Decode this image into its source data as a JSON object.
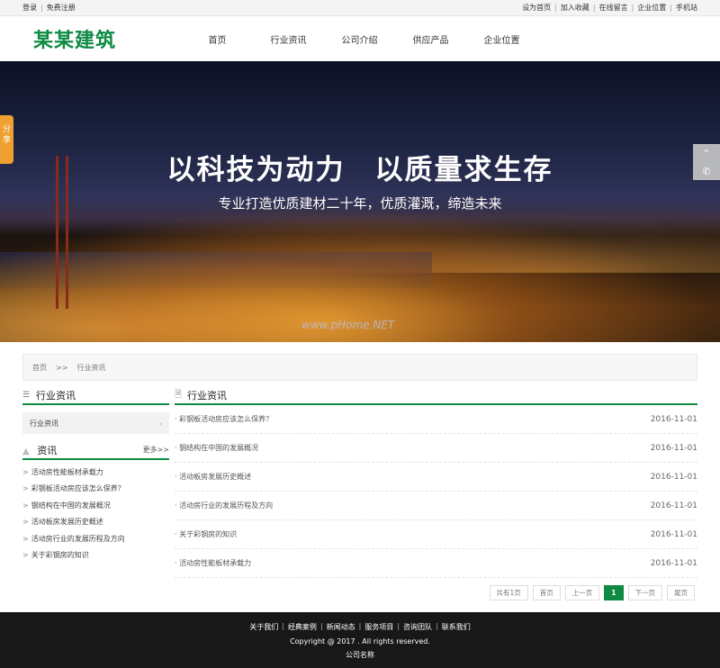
{
  "topbar": {
    "left": [
      "登录",
      "免费注册"
    ],
    "right": [
      "设为首页",
      "加入收藏",
      "在线留言",
      "企业位置",
      "手机站"
    ]
  },
  "header": {
    "logo": "某某建筑",
    "nav": [
      "首页",
      "行业资讯",
      "公司介绍",
      "供应产品",
      "企业位置"
    ]
  },
  "banner": {
    "headline": "以科技为动力　以质量求生存",
    "subline": "专业打造优质建材二十年，优质灌溉，缔造未来",
    "watermark": "www.pHome.NET",
    "share_label": "分享"
  },
  "breadcrumb": {
    "home": "首页",
    "arrow": ">>",
    "current": "行业资讯"
  },
  "sidebar": {
    "category_title": "行业资讯",
    "category_item": "行业资讯",
    "news_title": "资讯",
    "news_more": "更多>>",
    "news_items": [
      "活动房性能板材承载力",
      "彩钢板活动房应该怎么保养？",
      "钢结构在中国的发展概况",
      "活动板房发展历史概述",
      "活动房行业的发展历程及方向",
      "关于彩钢房的知识"
    ]
  },
  "main": {
    "title": "行业资讯",
    "articles": [
      {
        "title": "· 彩钢板活动房应该怎么保养？",
        "date": "2016-11-01"
      },
      {
        "title": "· 钢结构在中国的发展概况",
        "date": "2016-11-01"
      },
      {
        "title": "· 活动板房发展历史概述",
        "date": "2016-11-01"
      },
      {
        "title": "· 活动房行业的发展历程及方向",
        "date": "2016-11-01"
      },
      {
        "title": "· 关于彩钢房的知识",
        "date": "2016-11-01"
      },
      {
        "title": "· 活动房性能板材承载力",
        "date": "2016-11-01"
      }
    ]
  },
  "pager": {
    "total": "共有1页",
    "first": "首页",
    "prev": "上一页",
    "current": "1",
    "next": "下一页",
    "last": "尾页"
  },
  "footer": {
    "links": [
      "关于我们",
      "经典案例",
      "新闻动态",
      "服务项目",
      "咨询团队",
      "联系我们"
    ],
    "copyright": "Copyright @ 2017 . All rights reserved.",
    "company": "公司名称"
  },
  "colors": {
    "brand_green": "#0f8a44",
    "share_orange": "#f0a030",
    "footer_bg": "#181818"
  }
}
